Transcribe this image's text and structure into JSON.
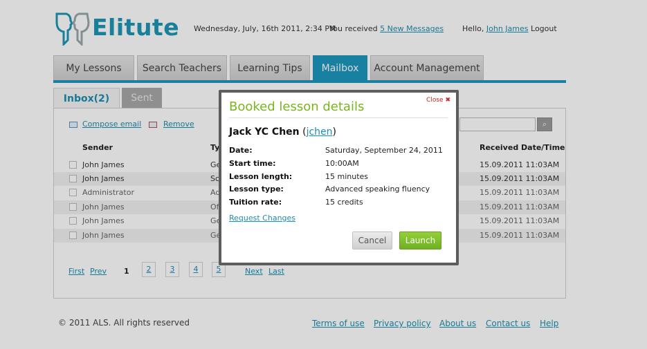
{
  "brand": {
    "name": "Elitute"
  },
  "header": {
    "datetime": "Wednesday, July, 16th 2011, 2:34 PM",
    "received_prefix": "You received ",
    "messages_link": "5 New Messages",
    "hello": "Hello,",
    "user_link": "John James",
    "logout": "Logout"
  },
  "nav": {
    "tabs": [
      {
        "label": "My Lessons"
      },
      {
        "label": "Search Teachers"
      },
      {
        "label": "Learning Tips"
      },
      {
        "label": "Mailbox"
      },
      {
        "label": "Account Management"
      }
    ]
  },
  "mailbox": {
    "tabs": [
      {
        "label": "Inbox(2)"
      },
      {
        "label": "Sent"
      }
    ],
    "compose": "Compose email",
    "remove": "Remove",
    "search_button": "⌕",
    "columns": {
      "sender": "Sender",
      "type": "Typ",
      "received": "Received Date/Time"
    },
    "rows": [
      {
        "sender": "John James",
        "type": "Ge",
        "date": "15.09.2011  11:03AM"
      },
      {
        "sender": "John James",
        "type": "Sch",
        "date": "15.09.2011  11:03AM"
      },
      {
        "sender": "Administrator",
        "type": "Adr",
        "date": "15.09.2011  11:03AM"
      },
      {
        "sender": "John James",
        "type": "Off",
        "date": "15.09.2011  11:03AM"
      },
      {
        "sender": "John James",
        "type": "Ge",
        "date": "15.09.2011  11:03AM"
      },
      {
        "sender": "John James",
        "type": "Ge",
        "date": "15.09.2011  11:03AM"
      }
    ],
    "pager": {
      "first": "First",
      "prev": "Prev",
      "pages": [
        "1",
        "2",
        "3",
        "4",
        "5"
      ],
      "next": "Next",
      "last": "Last"
    }
  },
  "footer": {
    "copyright": "© 2011 ALS. All rights reserved",
    "links": [
      "Terms of use",
      "Privacy policy",
      "About us",
      "Contact us",
      "Help"
    ]
  },
  "modal": {
    "title": "Booked lesson details",
    "close": "Close",
    "close_glyph": "✖",
    "teacher_name": "Jack YC Chen",
    "teacher_open": "(",
    "teacher_handle": "jchen",
    "teacher_close": ")",
    "details": [
      {
        "label": "Date:",
        "value": "Saturday, September 24, 2011"
      },
      {
        "label": "Start time:",
        "value": "10:00AM"
      },
      {
        "label": "Lesson length:",
        "value": "15 minutes"
      },
      {
        "label": "Lesson type:",
        "value": "Advanced speaking fluency"
      },
      {
        "label": "Tuition rate:",
        "value": "15 credits"
      }
    ],
    "request_link": "Request Changes",
    "cancel": "Cancel",
    "launch": "Launch"
  },
  "colors": {
    "accent": "#1d98bf",
    "modal_title": "#78b51e",
    "launch": "#7dbd28"
  }
}
